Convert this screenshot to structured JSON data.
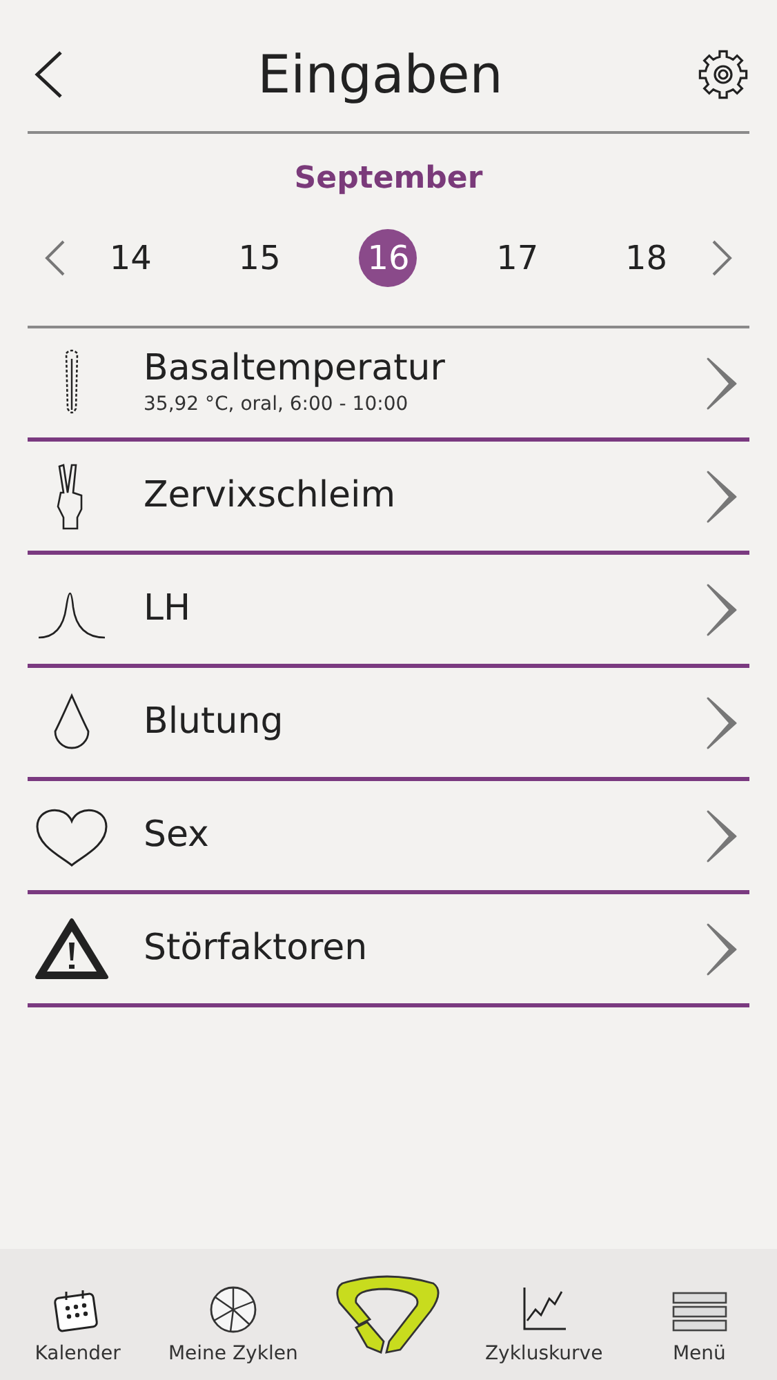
{
  "header": {
    "title": "Eingaben"
  },
  "month": "September",
  "days": [
    {
      "label": "14",
      "selected": false
    },
    {
      "label": "15",
      "selected": false
    },
    {
      "label": "16",
      "selected": true
    },
    {
      "label": "17",
      "selected": false
    },
    {
      "label": "18",
      "selected": false
    }
  ],
  "entries": [
    {
      "kind": "thermometer",
      "label": "Basaltemperatur",
      "detail": "35,92 °C, oral, 6:00 - 10:00"
    },
    {
      "kind": "hand",
      "label": "Zervixschleim"
    },
    {
      "kind": "peak",
      "label": "LH"
    },
    {
      "kind": "drop",
      "label": "Blutung"
    },
    {
      "kind": "heart",
      "label": "Sex"
    },
    {
      "kind": "warning",
      "label": "Störfaktoren"
    }
  ],
  "nav": [
    {
      "kind": "calendar",
      "label": "Kalender"
    },
    {
      "kind": "pie",
      "label": "Meine Zyklen"
    },
    {
      "kind": "logo"
    },
    {
      "kind": "chart",
      "label": "Zykluskurve"
    },
    {
      "kind": "menu",
      "label": "Menü"
    }
  ]
}
